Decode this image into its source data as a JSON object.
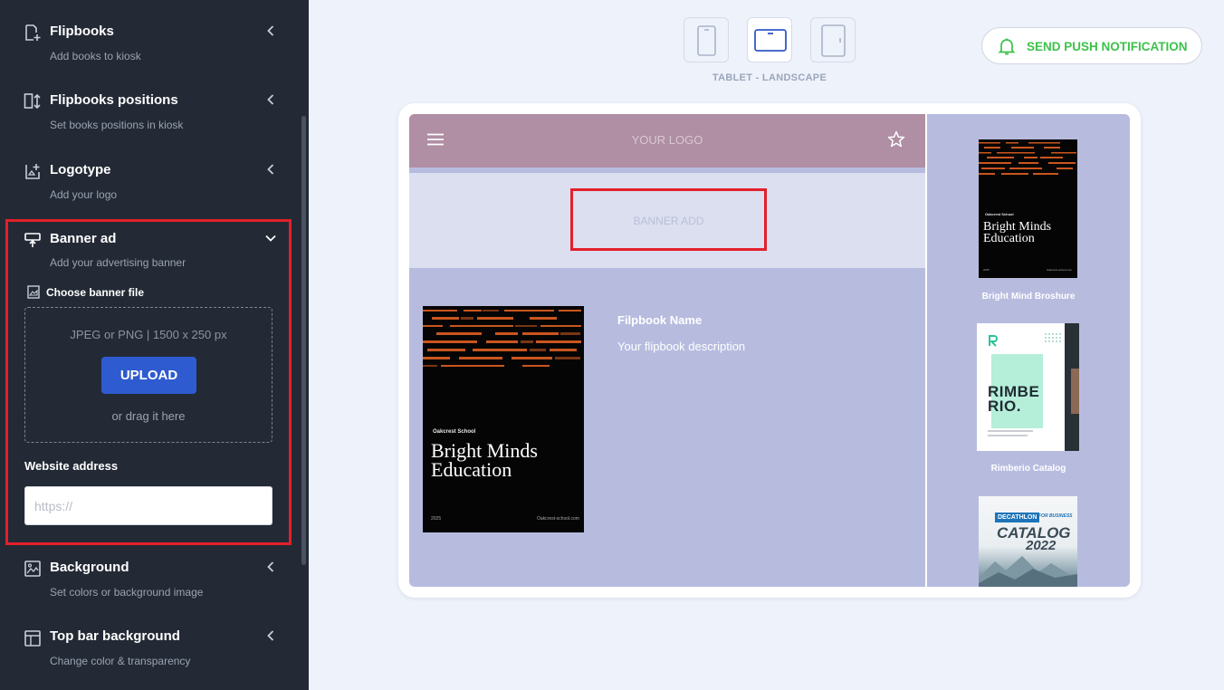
{
  "sidebar": {
    "sections": [
      {
        "title": "Flipbooks",
        "subtitle": "Add books to kiosk"
      },
      {
        "title": "Flipbooks positions",
        "subtitle": "Set books positions in kiosk"
      },
      {
        "title": "Logotype",
        "subtitle": "Add your logo"
      },
      {
        "title": "Banner ad",
        "subtitle": "Add your advertising banner"
      },
      {
        "title": "Background",
        "subtitle": "Set colors or background image"
      },
      {
        "title": "Top bar background",
        "subtitle": "Change color & transparency"
      }
    ],
    "banner": {
      "choose_label": "Choose banner file",
      "file_hint": "JPEG or PNG | 1500 x 250 px",
      "upload_label": "UPLOAD",
      "drag_label": "or drag it here",
      "website_label": "Website address",
      "website_placeholder": "https://",
      "website_value": ""
    }
  },
  "device": {
    "options": [
      "phone-portrait",
      "tablet-landscape",
      "tablet-portrait"
    ],
    "selected": "tablet-landscape",
    "mode_label": "TABLET - LANDSCAPE"
  },
  "push_button": {
    "label": "SEND PUSH NOTIFICATION"
  },
  "preview": {
    "logo_text": "YOUR LOGO",
    "banner_text": "BANNER ADD",
    "featured": {
      "name": "Filpbook Name",
      "description": "Your flipbook description",
      "cover": {
        "school": "Oakcrest School",
        "title_line1": "Bright Minds",
        "title_line2": "Education",
        "year": "2025",
        "site": "Oakcrest-school.com"
      }
    },
    "side_books": [
      {
        "label": "Bright Mind Broshure",
        "cover_school": "Oakcrest School",
        "cover_title_line1": "Bright Minds",
        "cover_title_line2": "Education",
        "cover_year": "2025",
        "cover_site": "Oakcrest-school.com"
      },
      {
        "label": "Rimberio Catalog",
        "cover_title_line1": "RIMBE",
        "cover_title_line2": "RIO."
      },
      {
        "label": "",
        "cover_brand": "DECATHLON",
        "cover_tag": "FOR BUSINESS",
        "cover_title": "CATALOG",
        "cover_year": "2022"
      }
    ]
  },
  "colors": {
    "sidebar_bg": "#232a35",
    "highlight": "#e3202b",
    "upload_btn": "#2f5bd0",
    "push_text": "#3cc24a",
    "topbar_bg": "#b08ea3",
    "screen_bg": "#b7bcdf"
  },
  "icons": [
    "flipbooks-add-icon",
    "positions-icon",
    "logotype-icon",
    "banner-ad-icon",
    "image-file-icon",
    "background-icon",
    "top-bar-icon",
    "chevron-left-icon",
    "chevron-down-icon",
    "bell-icon",
    "hamburger-icon",
    "star-icon",
    "phone-icon",
    "tablet-landscape-icon",
    "tablet-portrait-icon"
  ]
}
